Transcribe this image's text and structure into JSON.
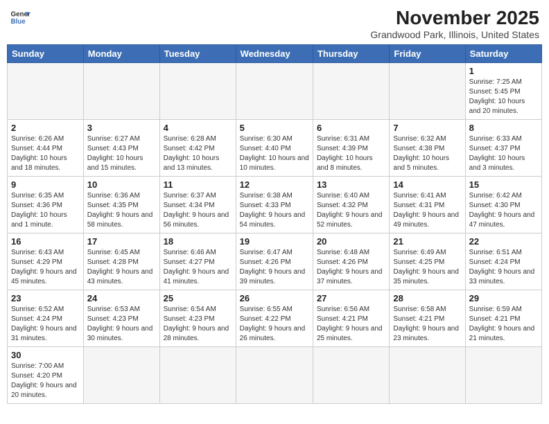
{
  "header": {
    "logo_line1": "General",
    "logo_line2": "Blue",
    "month": "November 2025",
    "location": "Grandwood Park, Illinois, United States"
  },
  "weekdays": [
    "Sunday",
    "Monday",
    "Tuesday",
    "Wednesday",
    "Thursday",
    "Friday",
    "Saturday"
  ],
  "weeks": [
    [
      {
        "day": "",
        "info": ""
      },
      {
        "day": "",
        "info": ""
      },
      {
        "day": "",
        "info": ""
      },
      {
        "day": "",
        "info": ""
      },
      {
        "day": "",
        "info": ""
      },
      {
        "day": "",
        "info": ""
      },
      {
        "day": "1",
        "info": "Sunrise: 7:25 AM\nSunset: 5:45 PM\nDaylight: 10 hours and 20 minutes."
      }
    ],
    [
      {
        "day": "2",
        "info": "Sunrise: 6:26 AM\nSunset: 4:44 PM\nDaylight: 10 hours and 18 minutes."
      },
      {
        "day": "3",
        "info": "Sunrise: 6:27 AM\nSunset: 4:43 PM\nDaylight: 10 hours and 15 minutes."
      },
      {
        "day": "4",
        "info": "Sunrise: 6:28 AM\nSunset: 4:42 PM\nDaylight: 10 hours and 13 minutes."
      },
      {
        "day": "5",
        "info": "Sunrise: 6:30 AM\nSunset: 4:40 PM\nDaylight: 10 hours and 10 minutes."
      },
      {
        "day": "6",
        "info": "Sunrise: 6:31 AM\nSunset: 4:39 PM\nDaylight: 10 hours and 8 minutes."
      },
      {
        "day": "7",
        "info": "Sunrise: 6:32 AM\nSunset: 4:38 PM\nDaylight: 10 hours and 5 minutes."
      },
      {
        "day": "8",
        "info": "Sunrise: 6:33 AM\nSunset: 4:37 PM\nDaylight: 10 hours and 3 minutes."
      }
    ],
    [
      {
        "day": "9",
        "info": "Sunrise: 6:35 AM\nSunset: 4:36 PM\nDaylight: 10 hours and 1 minute."
      },
      {
        "day": "10",
        "info": "Sunrise: 6:36 AM\nSunset: 4:35 PM\nDaylight: 9 hours and 58 minutes."
      },
      {
        "day": "11",
        "info": "Sunrise: 6:37 AM\nSunset: 4:34 PM\nDaylight: 9 hours and 56 minutes."
      },
      {
        "day": "12",
        "info": "Sunrise: 6:38 AM\nSunset: 4:33 PM\nDaylight: 9 hours and 54 minutes."
      },
      {
        "day": "13",
        "info": "Sunrise: 6:40 AM\nSunset: 4:32 PM\nDaylight: 9 hours and 52 minutes."
      },
      {
        "day": "14",
        "info": "Sunrise: 6:41 AM\nSunset: 4:31 PM\nDaylight: 9 hours and 49 minutes."
      },
      {
        "day": "15",
        "info": "Sunrise: 6:42 AM\nSunset: 4:30 PM\nDaylight: 9 hours and 47 minutes."
      }
    ],
    [
      {
        "day": "16",
        "info": "Sunrise: 6:43 AM\nSunset: 4:29 PM\nDaylight: 9 hours and 45 minutes."
      },
      {
        "day": "17",
        "info": "Sunrise: 6:45 AM\nSunset: 4:28 PM\nDaylight: 9 hours and 43 minutes."
      },
      {
        "day": "18",
        "info": "Sunrise: 6:46 AM\nSunset: 4:27 PM\nDaylight: 9 hours and 41 minutes."
      },
      {
        "day": "19",
        "info": "Sunrise: 6:47 AM\nSunset: 4:26 PM\nDaylight: 9 hours and 39 minutes."
      },
      {
        "day": "20",
        "info": "Sunrise: 6:48 AM\nSunset: 4:26 PM\nDaylight: 9 hours and 37 minutes."
      },
      {
        "day": "21",
        "info": "Sunrise: 6:49 AM\nSunset: 4:25 PM\nDaylight: 9 hours and 35 minutes."
      },
      {
        "day": "22",
        "info": "Sunrise: 6:51 AM\nSunset: 4:24 PM\nDaylight: 9 hours and 33 minutes."
      }
    ],
    [
      {
        "day": "23",
        "info": "Sunrise: 6:52 AM\nSunset: 4:24 PM\nDaylight: 9 hours and 31 minutes."
      },
      {
        "day": "24",
        "info": "Sunrise: 6:53 AM\nSunset: 4:23 PM\nDaylight: 9 hours and 30 minutes."
      },
      {
        "day": "25",
        "info": "Sunrise: 6:54 AM\nSunset: 4:23 PM\nDaylight: 9 hours and 28 minutes."
      },
      {
        "day": "26",
        "info": "Sunrise: 6:55 AM\nSunset: 4:22 PM\nDaylight: 9 hours and 26 minutes."
      },
      {
        "day": "27",
        "info": "Sunrise: 6:56 AM\nSunset: 4:21 PM\nDaylight: 9 hours and 25 minutes."
      },
      {
        "day": "28",
        "info": "Sunrise: 6:58 AM\nSunset: 4:21 PM\nDaylight: 9 hours and 23 minutes."
      },
      {
        "day": "29",
        "info": "Sunrise: 6:59 AM\nSunset: 4:21 PM\nDaylight: 9 hours and 21 minutes."
      }
    ],
    [
      {
        "day": "30",
        "info": "Sunrise: 7:00 AM\nSunset: 4:20 PM\nDaylight: 9 hours and 20 minutes."
      },
      {
        "day": "",
        "info": ""
      },
      {
        "day": "",
        "info": ""
      },
      {
        "day": "",
        "info": ""
      },
      {
        "day": "",
        "info": ""
      },
      {
        "day": "",
        "info": ""
      },
      {
        "day": "",
        "info": ""
      }
    ]
  ]
}
